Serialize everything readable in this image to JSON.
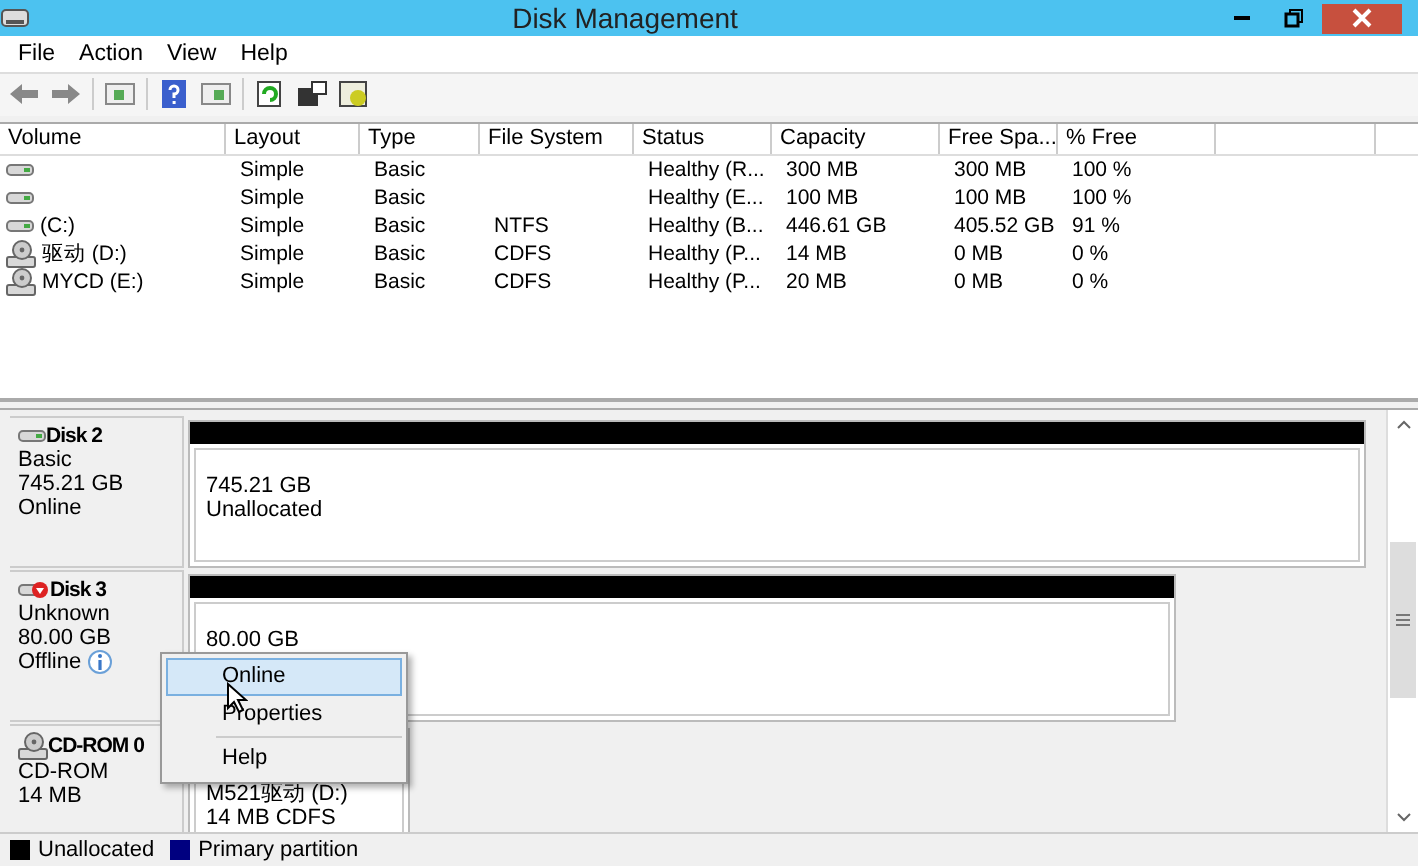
{
  "window": {
    "title": "Disk Management"
  },
  "menu": [
    "File",
    "Action",
    "View",
    "Help"
  ],
  "volume_table": {
    "columns": [
      "Volume",
      "Layout",
      "Type",
      "File System",
      "Status",
      "Capacity",
      "Free Spa...",
      "% Free"
    ],
    "rows": [
      {
        "kind": "disk",
        "cells": [
          "",
          "Simple",
          "Basic",
          "",
          "Healthy (R...",
          "300 MB",
          "300 MB",
          "100 %"
        ]
      },
      {
        "kind": "disk",
        "cells": [
          "",
          "Simple",
          "Basic",
          "",
          "Healthy (E...",
          "100 MB",
          "100 MB",
          "100 %"
        ]
      },
      {
        "kind": "disk",
        "cells": [
          "(C:)",
          "Simple",
          "Basic",
          "NTFS",
          "Healthy (B...",
          "446.61 GB",
          "405.52 GB",
          "91 %"
        ]
      },
      {
        "kind": "cdrom",
        "cells": [
          "驱动 (D:)",
          "Simple",
          "Basic",
          "CDFS",
          "Healthy (P...",
          "14 MB",
          "0 MB",
          "0 %"
        ]
      },
      {
        "kind": "cdrom",
        "cells": [
          "MYCD (E:)",
          "Simple",
          "Basic",
          "CDFS",
          "Healthy (P...",
          "20 MB",
          "0 MB",
          "0 %"
        ]
      }
    ]
  },
  "disks": [
    {
      "kind": "disk",
      "name": "Disk 2",
      "lines": [
        "Basic",
        "745.21 GB",
        "Online"
      ],
      "info": false,
      "volumes": [
        {
          "color": "#000000",
          "lines": [
            "745.21 GB",
            "Unallocated"
          ]
        }
      ]
    },
    {
      "kind": "offline",
      "name": "Disk 3",
      "lines": [
        "Unknown",
        "80.00 GB",
        "Offline"
      ],
      "info": true,
      "volumes": [
        {
          "color": "#000000",
          "lines": [
            "80.00 GB"
          ]
        }
      ]
    },
    {
      "kind": "cdrom",
      "name": "CD-ROM 0",
      "lines": [
        "CD-ROM",
        "14 MB"
      ],
      "info": false,
      "volumes": [
        {
          "lines": [
            "M521驱动 (D:)",
            "14 MB CDFS"
          ]
        }
      ]
    }
  ],
  "context_menu": [
    {
      "label": "Online",
      "selected": true
    },
    {
      "label": "Properties",
      "selected": false
    },
    {
      "label": "Help",
      "selected": false
    }
  ],
  "legend": [
    {
      "label": "Unallocated",
      "color": "#000000"
    },
    {
      "label": "Primary partition",
      "color": "#000080"
    }
  ]
}
